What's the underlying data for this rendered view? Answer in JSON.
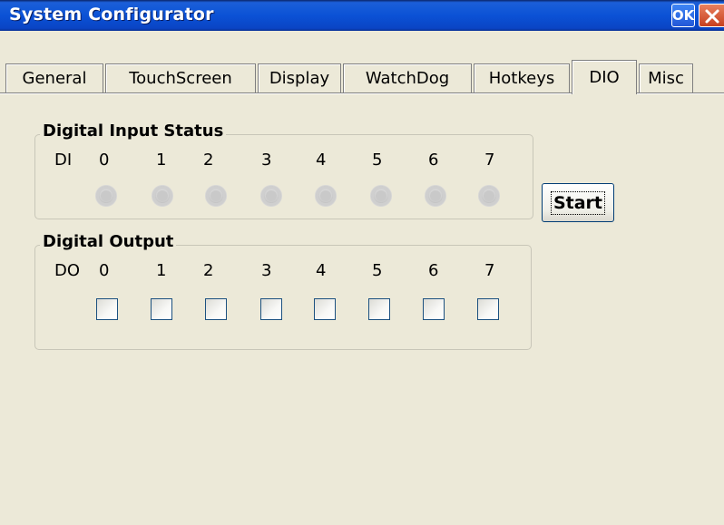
{
  "window": {
    "title": "System Configurator",
    "ok_label": "OK"
  },
  "tabs": [
    {
      "label": "General"
    },
    {
      "label": "TouchScreen"
    },
    {
      "label": "Display"
    },
    {
      "label": "WatchDog"
    },
    {
      "label": "Hotkeys"
    },
    {
      "label": "DIO",
      "active": true
    },
    {
      "label": "Misc"
    }
  ],
  "digital_input": {
    "title": "Digital Input Status",
    "prefix": "DI",
    "channels": [
      "0",
      "1",
      "2",
      "3",
      "4",
      "5",
      "6",
      "7"
    ]
  },
  "digital_output": {
    "title": "Digital Output",
    "prefix": "DO",
    "channels": [
      "0",
      "1",
      "2",
      "3",
      "4",
      "5",
      "6",
      "7"
    ]
  },
  "start_button": {
    "label": "Start"
  },
  "colors": {
    "titlebar": "#0b52d6",
    "background": "#ece9d8",
    "close": "#c7401f"
  }
}
